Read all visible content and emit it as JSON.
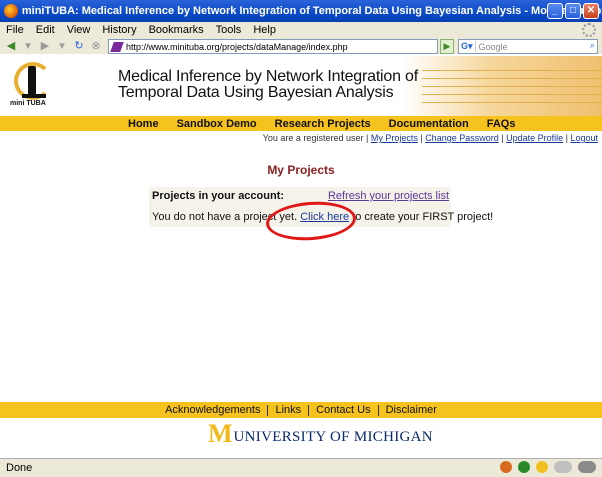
{
  "window": {
    "title": "miniTUBA: Medical Inference by Network Integration of Temporal Data Using Bayesian Analysis - Mozilla Firefox",
    "minimize_label": "_",
    "maximize_label": "□",
    "close_label": "✕"
  },
  "menu": [
    "File",
    "Edit",
    "View",
    "History",
    "Bookmarks",
    "Tools",
    "Help"
  ],
  "toolbar": {
    "url": "http://www.minituba.org/projects/dataManage/index.php",
    "search_placeholder": "Google"
  },
  "site": {
    "logo_text": "mini TUBA",
    "title_line1": "Medical Inference by Network Integration of",
    "title_line2": "Temporal Data Using Bayesian Analysis",
    "nav": [
      "Home",
      "Sandbox Demo",
      "Research Projects",
      "Documentation",
      "FAQs"
    ],
    "userbar_text": "You are a registered user |",
    "user_links": [
      "My Projects",
      "Change Password",
      "Update Profile",
      "Logout"
    ],
    "page_heading": "My Projects",
    "projects_label": "Projects in your account:",
    "refresh_link": "Refresh your projects list",
    "empty_msg_before": "You do not have a project yet.",
    "click_here": "Click here",
    "empty_msg_after": "to create your FIRST project!",
    "footer_links": [
      "Acknowledgements",
      "Links",
      "Contact Us",
      "Disclaimer"
    ],
    "university_m": "M",
    "university_text": "UNIVERSITY OF MICHIGAN"
  },
  "statusbar": {
    "text": "Done"
  },
  "colors": {
    "accent_yellow": "#f6c21e",
    "heading_red": "#8a2020",
    "annotation_red": "#e01818",
    "michigan_blue": "#0a2a6a",
    "michigan_maize": "#f2b817"
  }
}
